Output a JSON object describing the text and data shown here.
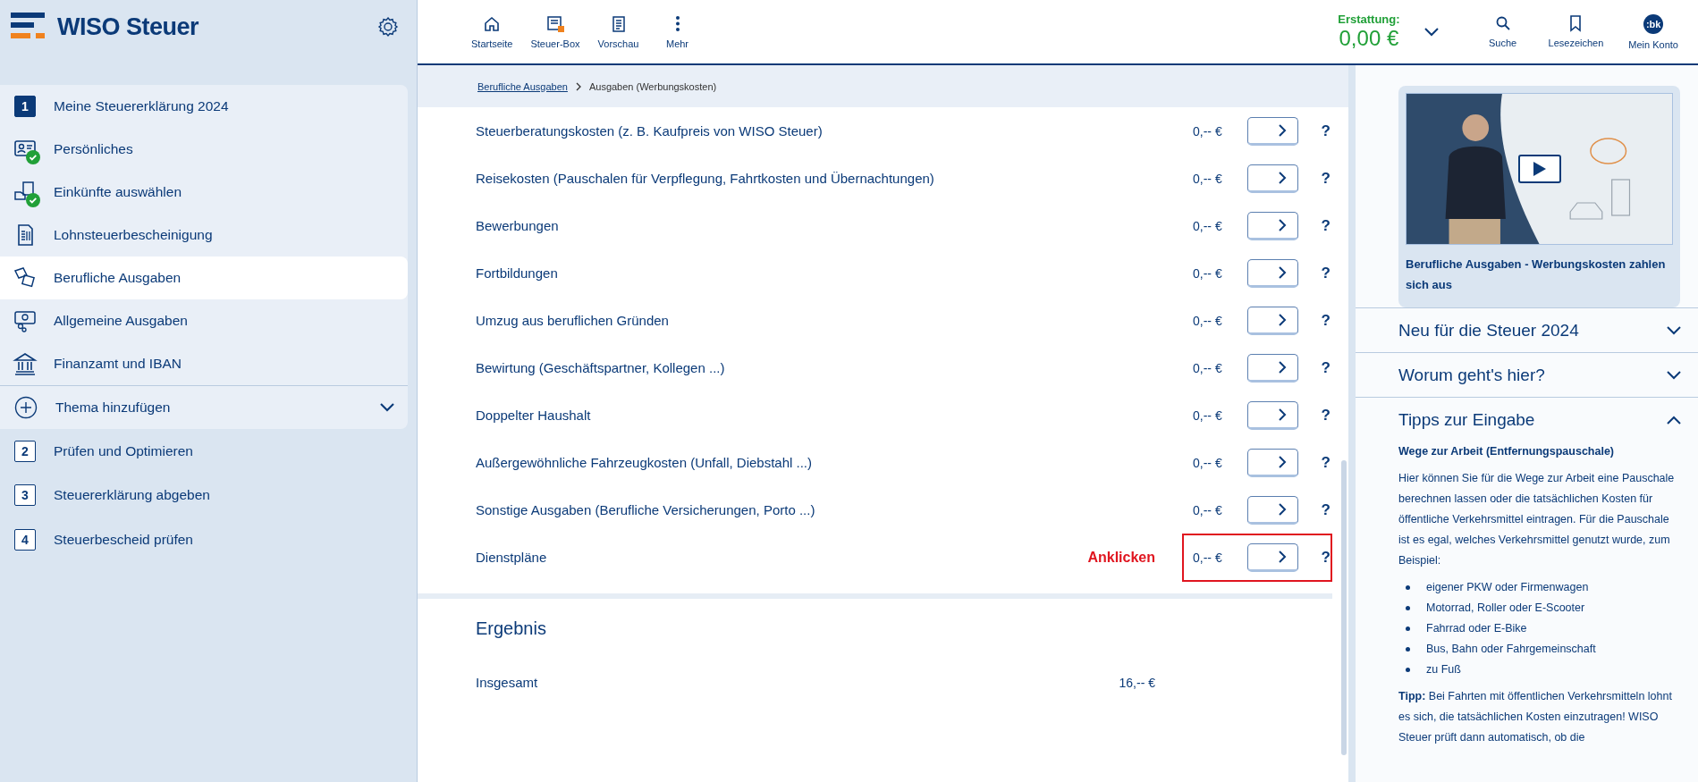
{
  "app": {
    "logo_text": "WISO Steuer"
  },
  "sidebar": {
    "steps": [
      {
        "number": "1",
        "label": "Meine Steuererklärung 2024",
        "selected": true,
        "expanded": true,
        "topics": [
          {
            "label": "Persönliches",
            "done": true,
            "selected": false
          },
          {
            "label": "Einkünfte auswählen",
            "done": true,
            "selected": false
          },
          {
            "label": "Lohnsteuerbescheinigung",
            "done": false,
            "selected": false
          },
          {
            "label": "Berufliche Ausgaben",
            "done": false,
            "selected": true
          },
          {
            "label": "Allgemeine Ausgaben",
            "done": false,
            "selected": false
          },
          {
            "label": "Finanzamt und IBAN",
            "done": false,
            "selected": false
          }
        ],
        "add_label": "Thema hinzufügen"
      },
      {
        "number": "2",
        "label": "Prüfen und Optimieren",
        "selected": false,
        "expanded": false
      },
      {
        "number": "3",
        "label": "Steuererklärung abgeben",
        "selected": false,
        "expanded": false
      },
      {
        "number": "4",
        "label": "Steuerbescheid prüfen",
        "selected": false,
        "expanded": false
      }
    ]
  },
  "toolbar": {
    "items": [
      {
        "label": "Startseite"
      },
      {
        "label": "Steuer-Box"
      },
      {
        "label": "Vorschau"
      },
      {
        "label": "Mehr"
      }
    ],
    "refund": {
      "label": "Erstattung:",
      "amount": "0,00 €"
    },
    "right_items": [
      {
        "kind": "search",
        "label": "Suche"
      },
      {
        "kind": "bookmark",
        "label": "Lesezeichen"
      },
      {
        "kind": "account",
        "label": "Mein Konto",
        "avatar": ":bk"
      }
    ]
  },
  "breadcrumb": [
    "Berufliche Ausgaben",
    "Ausgaben (Werbungskosten)"
  ],
  "expenses": [
    {
      "label": "Steuerberatungskosten (z. B. Kaufpreis von WISO Steuer)",
      "amount": "0,-- €",
      "help": "?",
      "highlighted": false
    },
    {
      "label": "Reisekosten (Pauschalen für Verpflegung, Fahrtkosten und Übernachtungen)",
      "amount": "0,-- €",
      "help": "?",
      "highlighted": false
    },
    {
      "label": "Bewerbungen",
      "amount": "0,-- €",
      "help": "?",
      "highlighted": false
    },
    {
      "label": "Fortbildungen",
      "amount": "0,-- €",
      "help": "?",
      "highlighted": false
    },
    {
      "label": "Umzug aus beruflichen Gründen",
      "amount": "0,-- €",
      "help": "?",
      "highlighted": false
    },
    {
      "label": "Bewirtung (Geschäftspartner, Kollegen ...)",
      "amount": "0,-- €",
      "help": "?",
      "highlighted": false
    },
    {
      "label": "Doppelter Haushalt",
      "amount": "0,-- €",
      "help": "?",
      "highlighted": false
    },
    {
      "label": "Außergewöhnliche Fahrzeugkosten (Unfall, Diebstahl ...)",
      "amount": "0,-- €",
      "help": "?",
      "highlighted": false
    },
    {
      "label": "Sonstige Ausgaben (Berufliche Versicherungen, Porto ...)",
      "amount": "0,-- €",
      "help": "?",
      "highlighted": false
    },
    {
      "label": "Dienstpläne",
      "amount": "0,-- €",
      "help": "?",
      "highlighted": true,
      "annotation": "Anklicken"
    }
  ],
  "result": {
    "title": "Ergebnis",
    "rows": [
      {
        "label": "Insgesamt",
        "amount": "16,-- €"
      }
    ]
  },
  "help_panel": {
    "video": {
      "kind": "picture",
      "caption": "Berufliche Ausgaben - Werbungskosten zahlen sich aus"
    },
    "sections": [
      {
        "title": "Neu für die Steuer 2024",
        "expanded": false
      },
      {
        "title": "Worum geht's hier?",
        "expanded": false
      },
      {
        "title": "Tipps zur Eingabe",
        "expanded": true
      }
    ],
    "tips": {
      "heading": "Wege zur Arbeit (Entfernungspauschale)",
      "text": "Hier können Sie für die Wege zur Arbeit eine Pauschale berechnen lassen oder die tatsächlichen Kosten für öffentliche Verkehrsmittel eintragen. Für die Pauschale ist es egal, welches Verkehrsmittel genutzt wurde, zum Beispiel:",
      "bullets": [
        "eigener PKW oder Firmenwagen",
        "Motorrad, Roller oder E-Scooter",
        "Fahrrad oder E-Bike",
        "Bus, Bahn oder Fahrgemeinschaft",
        "zu Fuß"
      ],
      "tip": "**Tipp:** Bei Fahrten mit öffentlichen Verkehrsmitteln lohnt es sich, die tatsächlichen Kosten einzutragen! WISO Steuer prüft dann automatisch, ob die"
    }
  }
}
